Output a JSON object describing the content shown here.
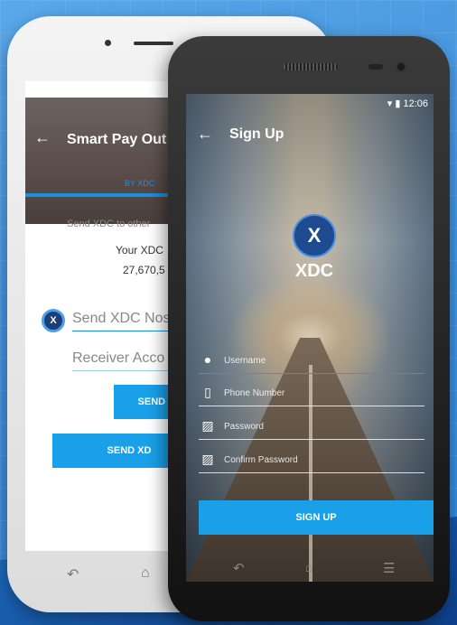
{
  "white_phone": {
    "title": "Smart Pay Out",
    "byline": "BY XDC",
    "send_to_text": "Send XDC to other",
    "your_balance_label": "Your XDC",
    "balance_value": "27,670,5",
    "coin_symbol": "X",
    "send_input_placeholder": "Send XDC Nos",
    "receiver_input_placeholder": "Receiver Acco",
    "send_button_1": "SEND XD",
    "send_button_2": "SEND XD"
  },
  "black_phone": {
    "status_time": "12:06",
    "title": "Sign Up",
    "logo_symbol": "X",
    "logo_text": "XDC",
    "fields": {
      "username": "Username",
      "phone": "Phone Number",
      "password": "Password",
      "confirm_password": "Confirm Password"
    },
    "signup_button": "SIGN UP"
  },
  "icons": {
    "back": "arrow-left-icon",
    "user": "user-icon",
    "phone": "phone-icon",
    "lock": "lock-icon",
    "nav_back": "nav-back-icon",
    "nav_home": "nav-home-icon",
    "nav_menu": "nav-menu-icon"
  },
  "colors": {
    "accent": "#1aa0e8",
    "logo_bg": "#1e4a8f"
  }
}
